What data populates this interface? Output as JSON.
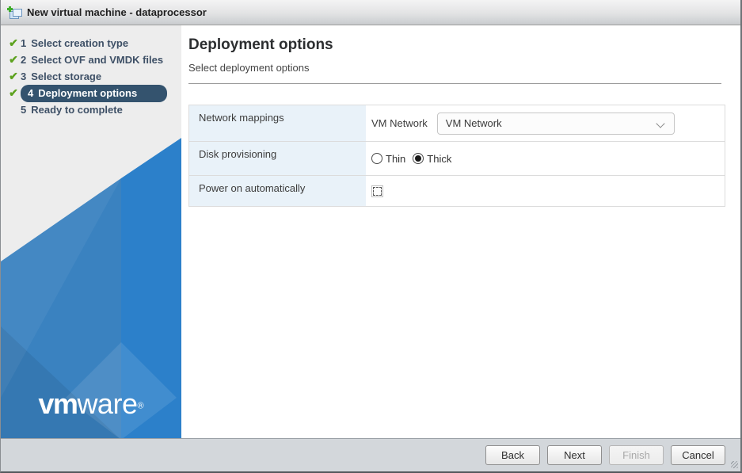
{
  "window": {
    "title": "New virtual machine - dataprocessor"
  },
  "icons": {
    "check": "✔"
  },
  "steps": [
    {
      "number": "1",
      "label": "Select creation type",
      "completed": true,
      "active": false
    },
    {
      "number": "2",
      "label": "Select OVF and VMDK files",
      "completed": true,
      "active": false
    },
    {
      "number": "3",
      "label": "Select storage",
      "completed": true,
      "active": false
    },
    {
      "number": "4",
      "label": "Deployment options",
      "completed": true,
      "active": true
    },
    {
      "number": "5",
      "label": "Ready to complete",
      "completed": false,
      "active": false
    }
  ],
  "content": {
    "heading": "Deployment options",
    "subheading": "Select deployment options"
  },
  "form": {
    "network": {
      "row_label": "Network mappings",
      "field_label": "VM Network",
      "dropdown_value": "VM Network"
    },
    "disk": {
      "row_label": "Disk provisioning",
      "options": [
        "Thin",
        "Thick"
      ],
      "selected": "Thick"
    },
    "power": {
      "row_label": "Power on automatically",
      "checked": false
    }
  },
  "footer": {
    "buttons": [
      {
        "label": "Back",
        "enabled": true
      },
      {
        "label": "Next",
        "enabled": true
      },
      {
        "label": "Finish",
        "enabled": false
      },
      {
        "label": "Cancel",
        "enabled": true
      }
    ]
  },
  "logo": {
    "bold": "vm",
    "rest": "ware",
    "reg": "®"
  },
  "colors": {
    "active_step_bg": "#34536e",
    "check_green": "#5da21f",
    "sidebar_blue": "#2c80ca",
    "label_cell_bg": "#e9f2f9",
    "footer_bg": "#d3d7db"
  }
}
